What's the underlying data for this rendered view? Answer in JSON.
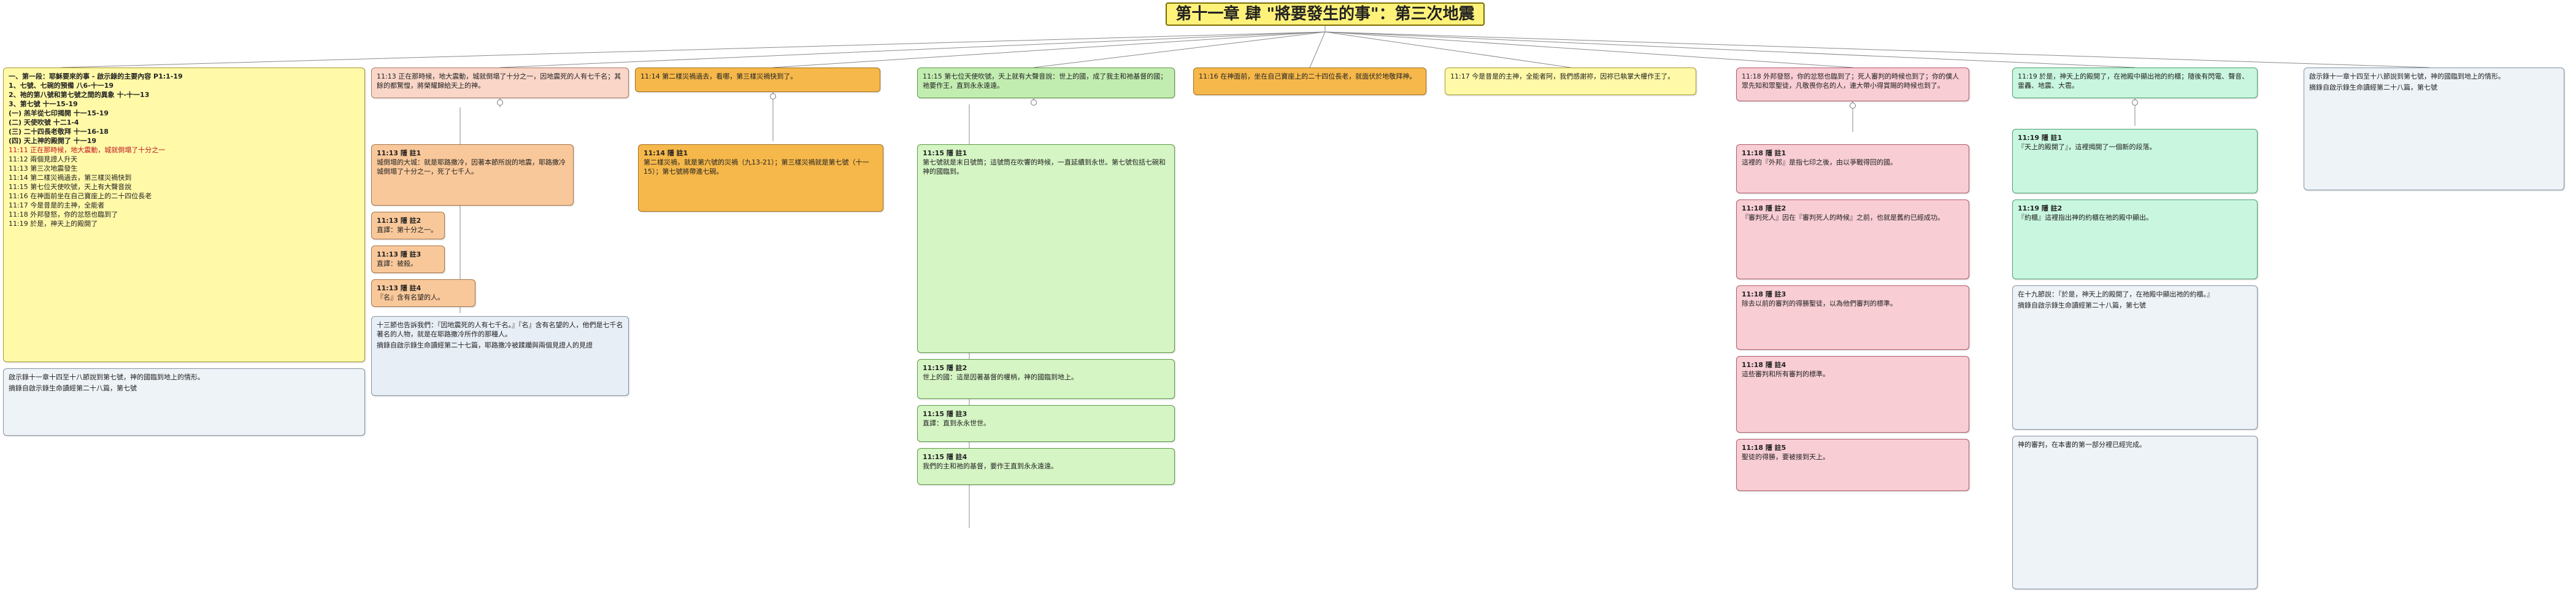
{
  "title": "第十一章 肆 \"將要發生的事\"：第三次地震",
  "outline": {
    "items": [
      "一、第一段：耶穌要來的事 - 啟示錄的主要內容  P1:1-19",
      "1、七號、七碗的預備  八6-十一19",
      "2、祂的第八號和第七號之間的異象  十-十一13",
      "3、第七號  十一15-19",
      "(一) 羔羊從七印揭開  十一15-19",
      "(二) 天使吹號  十二1-4",
      "(三) 二十四長老敬拜  十一16-18",
      "(四) 天上神的殿開了  十一19",
      "11:11 正在那時候，地大震動，城就倒塌了十分之一",
      "11:12 兩個見證人升天",
      "11:13 第三次地震發生",
      "11:14 第二樣災禍過去，第三樣災禍快到",
      "11:15 第七位天使吹號，天上有大聲音說",
      "11:16 在神面前坐在自己寶座上的二十四位長老",
      "11:17 今是昔是的主神，全能者",
      "11:18 外邦發怒，你的忿怒也臨到了",
      "11:19 於是，神天上的殿開了"
    ],
    "note": "啟示錄十一章十四至十八節說到第七號，神的國臨到地上的情形。",
    "footer": "摘錄自啟示錄生命讀經第二十八篇，第七號"
  },
  "col2": {
    "head": "11:13 正在那時候，地大震動，城就倒塌了十分之一，因地震死的人有七千名；其餘的都驚惶，將榮耀歸給天上的神。",
    "sub": [
      {
        "label": "11:13 隱 註1",
        "text": "城倒塌的大城：就是耶路撒冷，因著本節所說的地震，耶路撒冷城倒塌了十分之一，死了七千人。"
      },
      {
        "label": "11:13 隱 註2",
        "text": "直譯：第十分之一。"
      },
      {
        "label": "11:13 隱 註3",
        "text": "直譯：被殺。"
      },
      {
        "label": "11:13 隱 註4",
        "text": "『名』含有名望的人。"
      }
    ],
    "note": "十三節也告訴我們：『因地震死的人有七千名。』『名』含有名望的人，他們是七千名著名的人物，就是在耶路撒冷所作的那種人。",
    "footer": "摘錄自啟示錄生命讀經第二十七篇，耶路撒冷被蹂躪與兩個見證人的見證"
  },
  "col3": {
    "head": "11:14 第二樣災禍過去，看哪，第三樣災禍快到了。",
    "sub": [
      {
        "label": "11:14 隱 註1",
        "text": "第二樣災禍，就是第六號的災禍（九13-21）；第三樣災禍就是第七號（十一15）；第七號將帶進七碗。"
      }
    ]
  },
  "col4": {
    "head": "11:15 第七位天使吹號，天上就有大聲音說：世上的國，成了我主和祂基督的國；祂要作王，直到永永遠遠。",
    "sub": [
      {
        "label": "11:15 隱 註1",
        "text": "第七號就是末日號筒；這號筒在吹響的時候，一直延續到永世。第七號包括七碗和神的國臨到。"
      },
      {
        "label": "11:15 隱 註2",
        "text": "世上的國：這是因著基督的權柄，神的國臨到地上。"
      },
      {
        "label": "11:15 隱 註3",
        "text": "直譯：直到永永世世。"
      },
      {
        "label": "11:15 隱 註4",
        "text": "我們的主和祂的基督，要作王直到永永遠遠。"
      }
    ]
  },
  "col5": {
    "head": "11:16 在神面前，坐在自己寶座上的二十四位長老，就面伏於地敬拜神。"
  },
  "col6": {
    "head": "11:17 今是昔是的主神，全能者阿，我們感謝祢，因祢已執掌大權作王了。"
  },
  "col7": {
    "head": "11:18 外邦發怒，你的忿怒也臨到了；死人審判的時候也到了；你的僕人眾先知和眾聖徒，凡敬畏你名的人，連大帶小得賞賜的時候也到了。",
    "sub": [
      {
        "label": "11:18 隱 註1",
        "text": "這裡的『外邦』是指七印之後，由以爭戰得回的國。"
      },
      {
        "label": "11:18 隱 註2",
        "text": "『審判死人』因在『審判死人的時候』之前，也就是舊約已經成功。"
      },
      {
        "label": "11:18 隱 註3",
        "text": "除去以前的審判的得勝聖徒，以為他們審判的標準。"
      },
      {
        "label": "11:18 隱 註4",
        "text": "這些審判和所有審判的標準。"
      },
      {
        "label": "11:18 隱 註5",
        "text": "聖徒的得勝，要被接到天上。"
      }
    ]
  },
  "col8": {
    "head": "11:19 於是，神天上的殿開了，在祂殿中顯出祂的約櫃；隨後有閃電、聲音、雷轟、地震、大雹。",
    "sub": [
      {
        "label": "11:19 隱 註1",
        "text": "『天上的殿開了』，這裡揭開了一個新的段落。"
      },
      {
        "label": "11:19 隱 註2",
        "text": "『約櫃』這裡指出神的約櫃在祂的殿中顯出。"
      }
    ],
    "notes": [
      "在十九節說：『於是，神天上的殿開了，在祂殿中顯出祂的約櫃。』",
      "神的審判，在本書的第一部分裡已經完成。"
    ],
    "footer": "摘錄自啟示錄生命讀經第二十八篇，第七號"
  },
  "col9": {
    "note": "啟示錄十一章十四至十八節說到第七號，神的國臨到地上的情形。",
    "footer": "摘錄自啟示錄生命讀經第二十八篇，第七號"
  }
}
